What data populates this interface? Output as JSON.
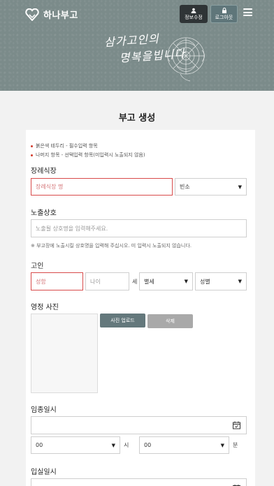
{
  "header": {
    "logo_text": "하나부고",
    "edit_button": "정보수정",
    "logout_button": "로그아웃",
    "slogan_line1": "삼가고인의",
    "slogan_line2": "명복을빕니다"
  },
  "page": {
    "title": "부고 생성"
  },
  "notes": {
    "required": "붉은색 테두리 - 필수입력 항목",
    "optional": "나머지 항목 - 선택입력 항목(미입력시 노출되지 않음)"
  },
  "funeral_hall": {
    "label": "장례식장",
    "name_placeholder": "장례식장 명",
    "room_select": "빈소"
  },
  "exposure_name": {
    "label": "노출상호",
    "placeholder": "노출될 상호명을 입력해주세요.",
    "hint": "※ 부고장에 노출시킬 상호명을 입력해 주십시오. 미 입력시 노출되지 않습니다."
  },
  "deceased": {
    "label": "고인",
    "name_placeholder": "성함",
    "age_placeholder": "나이",
    "age_unit": "세",
    "title_select": "별세",
    "gender_select": "성별"
  },
  "portrait": {
    "label": "영정 사진",
    "upload_button": "사진 업로드",
    "delete_button": "삭제"
  },
  "death_datetime": {
    "label": "임종일시",
    "hour_value": "00",
    "hour_unit": "시",
    "minute_value": "00",
    "minute_unit": "분"
  },
  "encoffin_datetime": {
    "label": "입실일시"
  },
  "colors": {
    "header_bg": "#7b8b8a",
    "required_border": "#d84a4a",
    "upload_button": "#64787c",
    "delete_button": "#a9a9a9"
  }
}
